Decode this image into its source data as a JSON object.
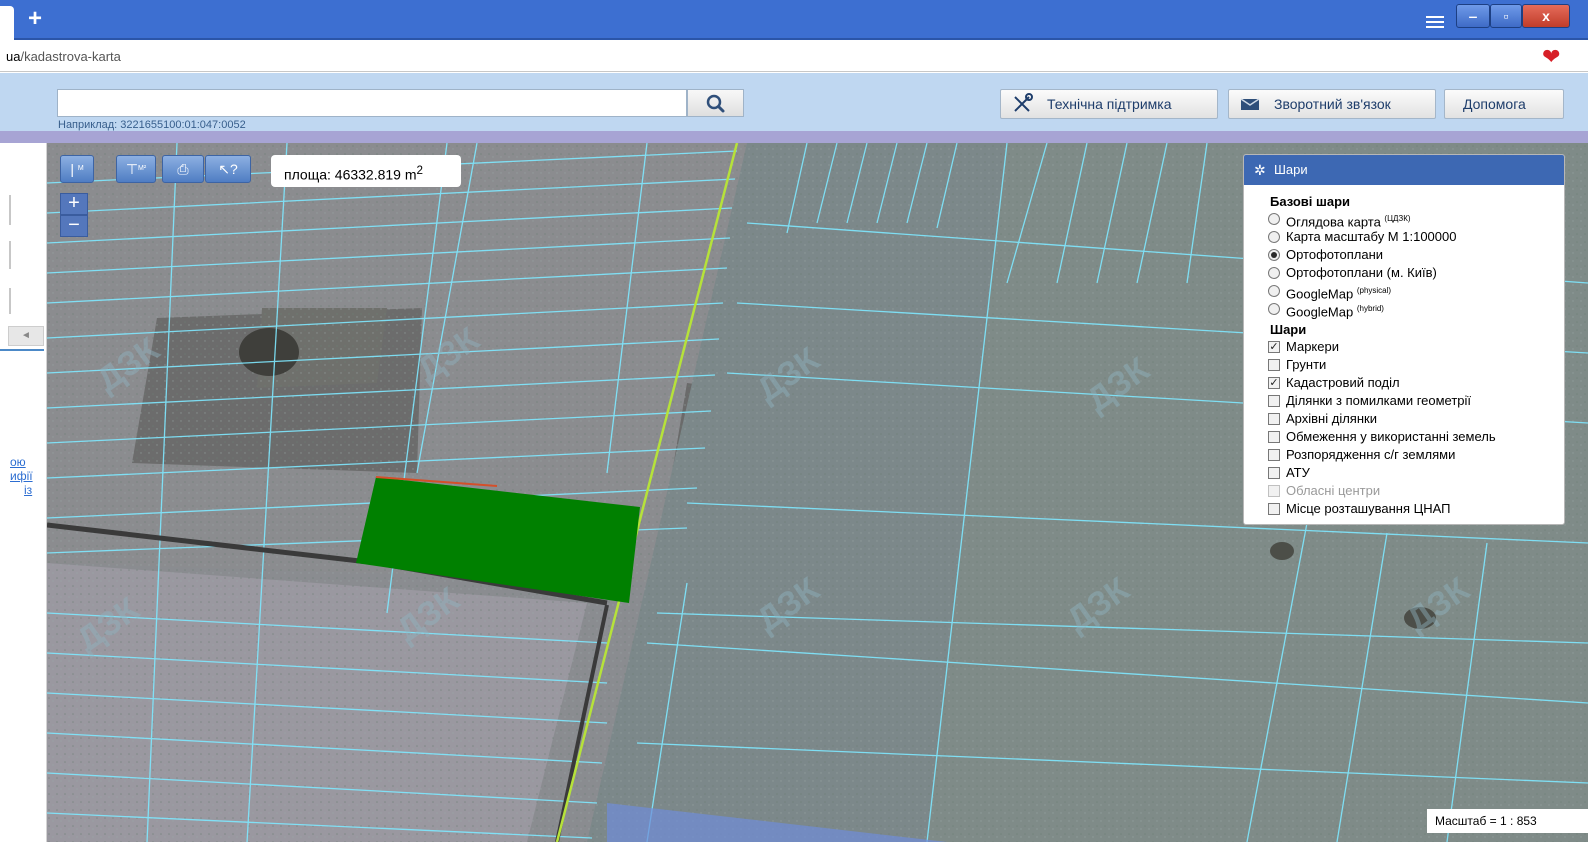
{
  "browser": {
    "new_tab": "+",
    "url_host": "ua",
    "url_path": "/kadastrova-karta",
    "min": "‒",
    "max": "▫",
    "close": "x",
    "favorite_icon": "heart-icon"
  },
  "header": {
    "search_placeholder": "",
    "search_hint": "Наприклад: 3221655100:01:047:0052",
    "support_label": "Технічна підтримка",
    "feedback_label": "Зворотний зв'язок",
    "help_label": "Допомога"
  },
  "left_panel": {
    "links": [
      "ою",
      "ифії",
      "із"
    ],
    "collapse_arrow": "◄"
  },
  "map": {
    "tool_measure_line": "|",
    "tool_measure_line_unit": "M",
    "tool_measure_area": "⊤",
    "tool_measure_area_unit": "M²",
    "tool_print": "⎙",
    "tool_info": "↖?",
    "area_text": "площа: 46332.819 m",
    "area_sup": "2",
    "zoom_in": "+",
    "zoom_out": "−",
    "scale_text": "Масштаб = 1 : 853",
    "watermark": "ДЗК",
    "highlight_color": "#008000",
    "parcel_line_color": "#7fe8ff",
    "road_line_color": "#b6e23a"
  },
  "layers": {
    "title": "Шари",
    "base_title": "Базові шари",
    "base": [
      {
        "label": "Оглядова карта",
        "sup": "(ЦДЗК)",
        "selected": false
      },
      {
        "label": "Карта масштабу М 1:100000",
        "sup": "",
        "selected": false
      },
      {
        "label": "Ортофотоплани",
        "sup": "",
        "selected": true
      },
      {
        "label": "Ортофотоплани (м. Київ)",
        "sup": "",
        "selected": false
      },
      {
        "label": "GoogleMap",
        "sup": "(physical)",
        "selected": false
      },
      {
        "label": "GoogleMap",
        "sup": "(hybrid)",
        "selected": false
      }
    ],
    "overlay_title": "Шари",
    "overlays": [
      {
        "label": "Маркери",
        "checked": true,
        "disabled": false
      },
      {
        "label": "Грунти",
        "checked": false,
        "disabled": false
      },
      {
        "label": "Кадастровий поділ",
        "checked": true,
        "disabled": false
      },
      {
        "label": "Ділянки з помилками геометрії",
        "checked": false,
        "disabled": false
      },
      {
        "label": "Архівні ділянки",
        "checked": false,
        "disabled": false
      },
      {
        "label": "Обмеження у використанні земель",
        "checked": false,
        "disabled": false
      },
      {
        "label": "Розпорядження с/г землями",
        "checked": false,
        "disabled": false
      },
      {
        "label": "АТУ",
        "checked": false,
        "disabled": false
      },
      {
        "label": "Обласні центри",
        "checked": false,
        "disabled": true
      },
      {
        "label": "Місце розташування ЦНАП",
        "checked": false,
        "disabled": false
      }
    ]
  }
}
